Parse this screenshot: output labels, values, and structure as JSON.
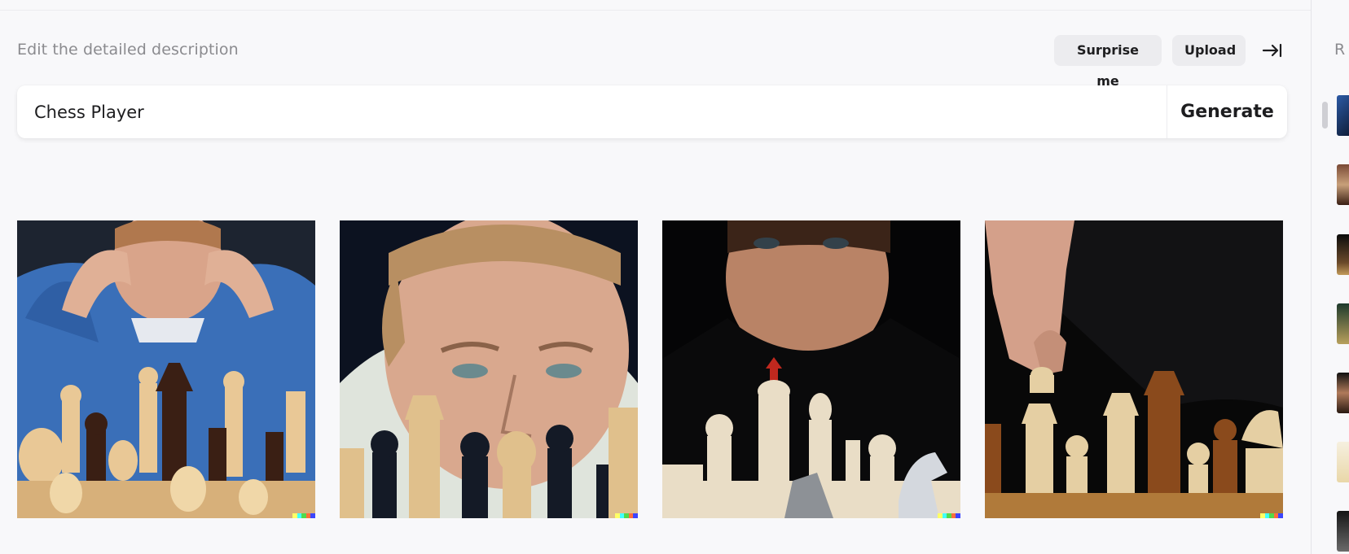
{
  "editor": {
    "heading": "Edit the detailed description",
    "surprise_label": "Surprise me",
    "upload_label": "Upload",
    "collapse_icon": "arrow-right-to-bar-icon",
    "prompt_value": "Chess Player",
    "generate_label": "Generate"
  },
  "results": [
    {
      "subject": "man in blue shirt holding head over chess pieces"
    },
    {
      "subject": "blond man staring at chess pieces"
    },
    {
      "subject": "man in black behind white chess pieces"
    },
    {
      "subject": "hand moving a chess piece on a board"
    }
  ],
  "sidebar": {
    "title": "R",
    "thumbnail_count": 7
  },
  "colors": {
    "background": "#f8f8fa",
    "pill": "#ececef",
    "text": "#1d1d1f",
    "muted": "#8b8b8f",
    "signature": [
      "#ffff66",
      "#42ffff",
      "#51da4c",
      "#ff6e3c",
      "#3c46ff"
    ]
  }
}
